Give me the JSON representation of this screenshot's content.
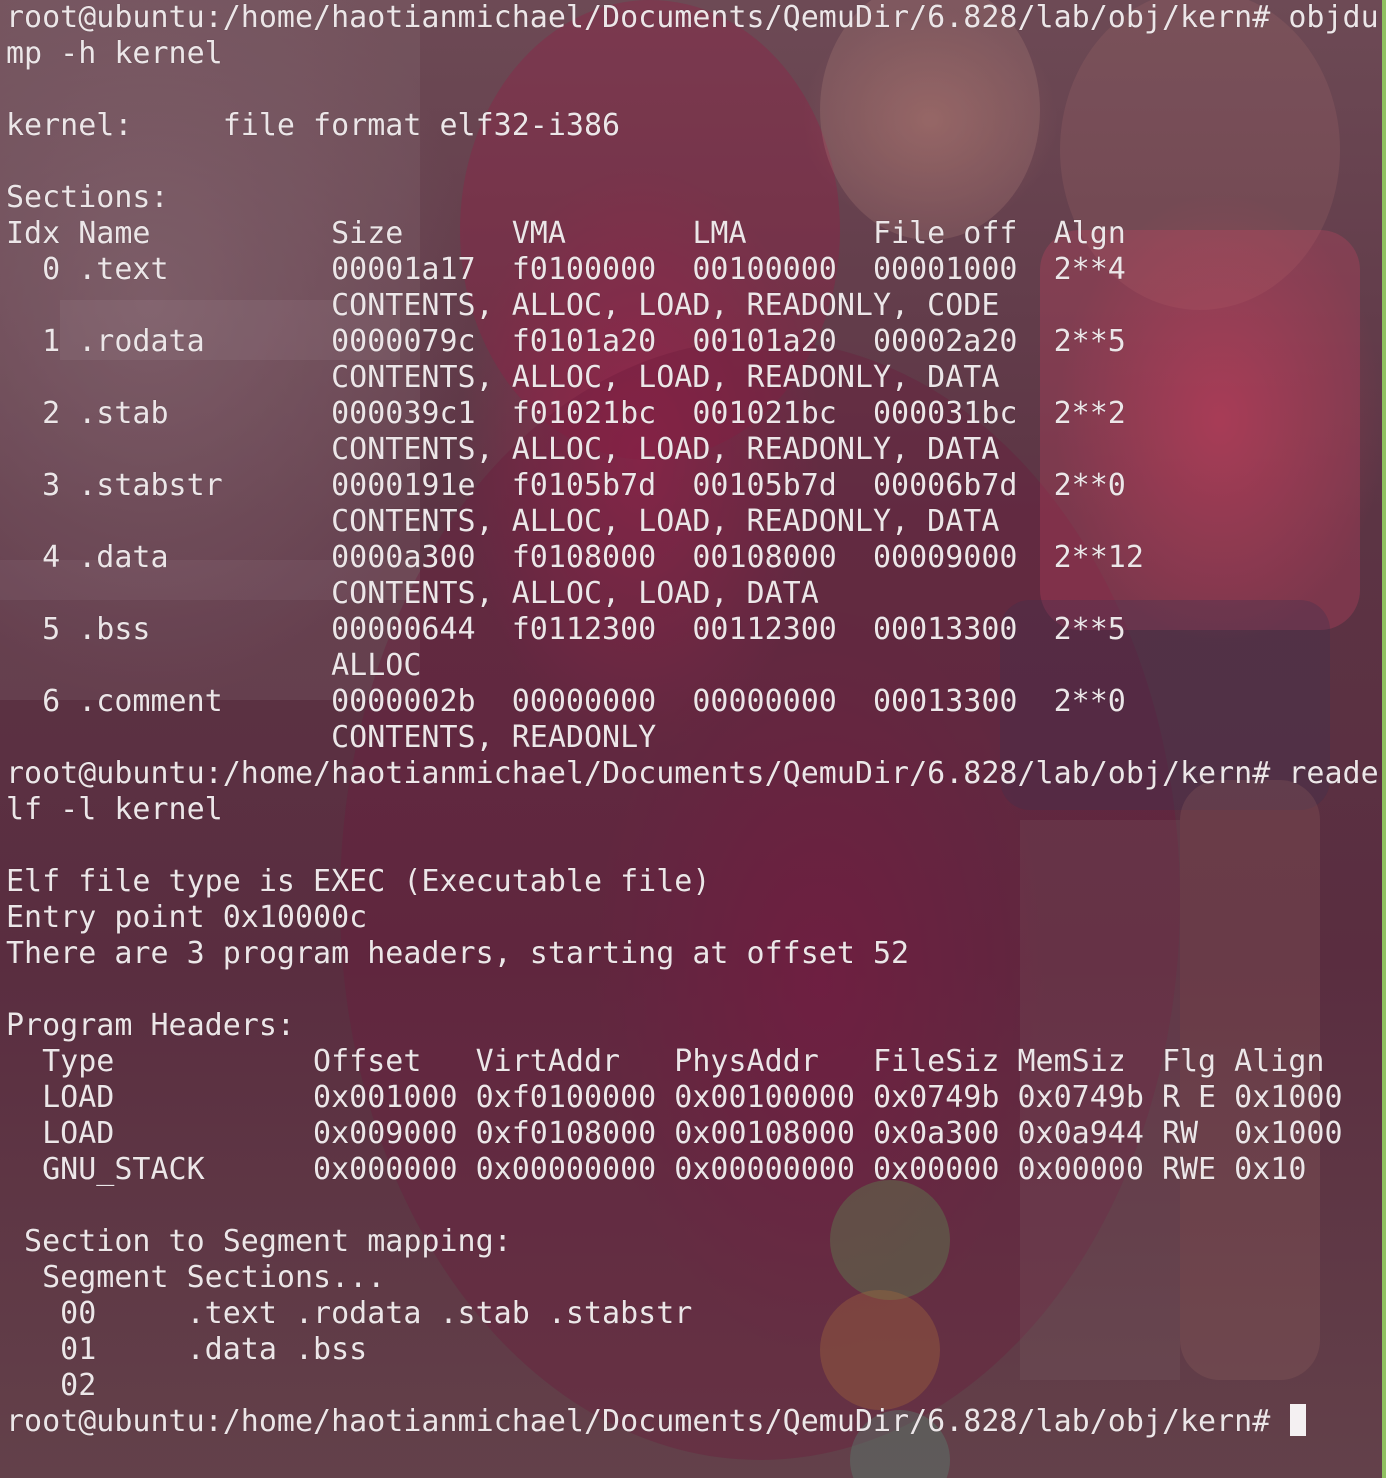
{
  "terminal": {
    "lines": [
      "root@ubuntu:/home/haotianmichael/Documents/QemuDir/6.828/lab/obj/kern# objdu",
      "mp -h kernel",
      "",
      "kernel:     file format elf32-i386",
      "",
      "Sections:",
      "Idx Name          Size      VMA       LMA       File off  Algn",
      "  0 .text         00001a17  f0100000  00100000  00001000  2**4",
      "                  CONTENTS, ALLOC, LOAD, READONLY, CODE",
      "  1 .rodata       0000079c  f0101a20  00101a20  00002a20  2**5",
      "                  CONTENTS, ALLOC, LOAD, READONLY, DATA",
      "  2 .stab         000039c1  f01021bc  001021bc  000031bc  2**2",
      "                  CONTENTS, ALLOC, LOAD, READONLY, DATA",
      "  3 .stabstr      0000191e  f0105b7d  00105b7d  00006b7d  2**0",
      "                  CONTENTS, ALLOC, LOAD, READONLY, DATA",
      "  4 .data         0000a300  f0108000  00108000  00009000  2**12",
      "                  CONTENTS, ALLOC, LOAD, DATA",
      "  5 .bss          00000644  f0112300  00112300  00013300  2**5",
      "                  ALLOC",
      "  6 .comment      0000002b  00000000  00000000  00013300  2**0",
      "                  CONTENTS, READONLY",
      "root@ubuntu:/home/haotianmichael/Documents/QemuDir/6.828/lab/obj/kern# reade",
      "lf -l kernel",
      "",
      "Elf file type is EXEC (Executable file)",
      "Entry point 0x10000c",
      "There are 3 program headers, starting at offset 52",
      "",
      "Program Headers:",
      "  Type           Offset   VirtAddr   PhysAddr   FileSiz MemSiz  Flg Align",
      "  LOAD           0x001000 0xf0100000 0x00100000 0x0749b 0x0749b R E 0x1000",
      "  LOAD           0x009000 0xf0108000 0x00108000 0x0a300 0x0a944 RW  0x1000",
      "  GNU_STACK      0x000000 0x00000000 0x00000000 0x00000 0x00000 RWE 0x10",
      "",
      " Section to Segment mapping:",
      "  Segment Sections...",
      "   00     .text .rodata .stab .stabstr",
      "   01     .data .bss",
      "   02     ",
      "root@ubuntu:/home/haotianmichael/Documents/QemuDir/6.828/lab/obj/kern# "
    ]
  },
  "colors": {
    "foreground": "#ece6e8",
    "cursor": "#f4f0f2",
    "background_tint": "#5a2d40",
    "edge_accent": "#8fc060"
  }
}
